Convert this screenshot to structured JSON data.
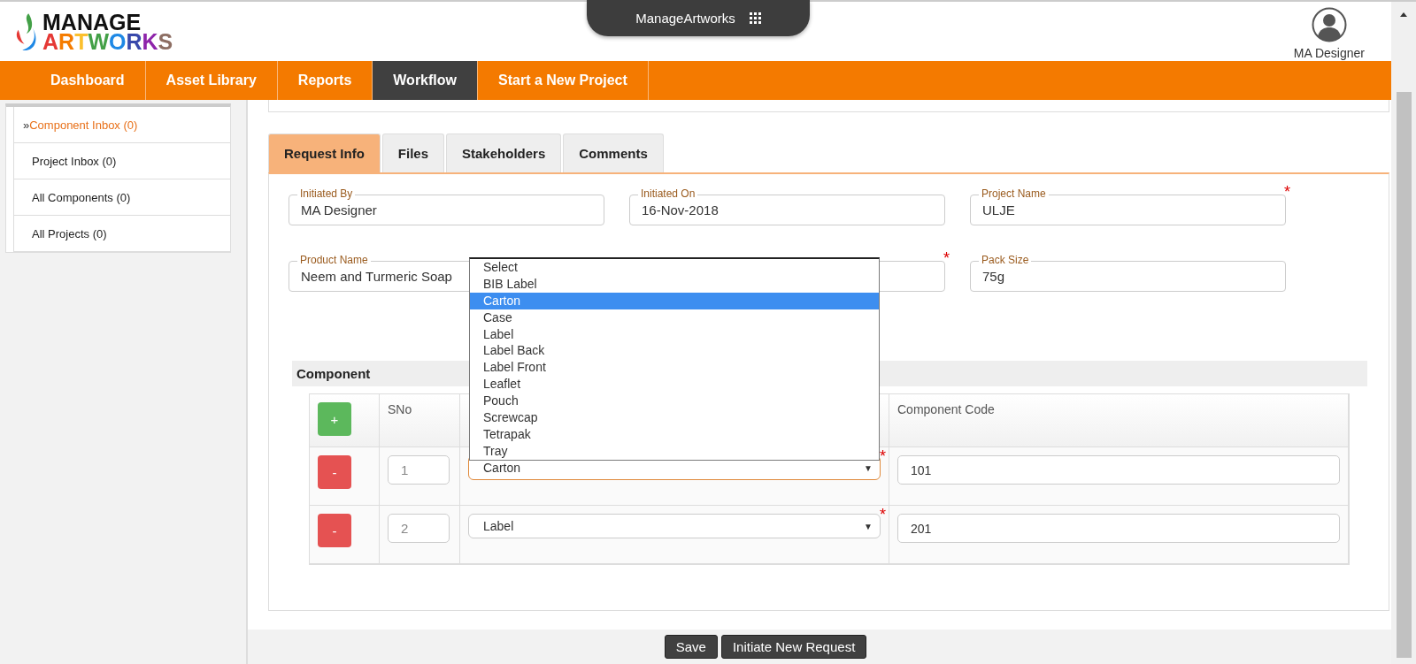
{
  "logo": {
    "line_1": "MANAGE",
    "line_2": "ARTWORKS"
  },
  "app_switcher": {
    "label": "ManageArtworks"
  },
  "user": {
    "name": "MA Designer"
  },
  "nav": [
    {
      "label": "Dashboard",
      "selected": false
    },
    {
      "label": "Asset Library",
      "selected": false
    },
    {
      "label": "Reports",
      "selected": false
    },
    {
      "label": "Workflow",
      "selected": true
    },
    {
      "label": "Start a New Project",
      "selected": false
    }
  ],
  "sidebar": {
    "marker": "»",
    "items": [
      {
        "label": "Component Inbox (0)",
        "selected": true
      },
      {
        "label": "Project Inbox (0)",
        "selected": false
      },
      {
        "label": "All Components (0)",
        "selected": false
      },
      {
        "label": "All Projects (0)",
        "selected": false
      }
    ]
  },
  "tabs": [
    {
      "label": "Request Info",
      "selected": true
    },
    {
      "label": "Files",
      "selected": false
    },
    {
      "label": "Stakeholders",
      "selected": false
    },
    {
      "label": "Comments",
      "selected": false
    }
  ],
  "fields": [
    {
      "label": "Initiated By",
      "value": "MA Designer"
    },
    {
      "label": "Initiated On",
      "value": "16-Nov-2018"
    },
    {
      "label": "Project Name",
      "value": "ULJE",
      "required_mark": "*"
    },
    {
      "label": "Product Name",
      "value": "Neem and Turmeric Soap"
    },
    {
      "required_mark": "*"
    },
    {
      "label": "Pack Size",
      "value": "75g"
    }
  ],
  "component": {
    "title": "Component",
    "add_button": "+",
    "columns": [
      "SNo",
      "Component Code"
    ],
    "rows": [
      {
        "remove": "-",
        "sno": "1",
        "type": "Carton",
        "caret": "▼",
        "required_mark": "*",
        "code": "101",
        "focused": true
      },
      {
        "remove": "-",
        "sno": "2",
        "type": "Label",
        "caret": "▼",
        "required_mark": "*",
        "code": "201",
        "focused": false
      }
    ]
  },
  "dropdown": {
    "options": [
      {
        "label": "Select",
        "selected": false
      },
      {
        "label": "BIB Label",
        "selected": false
      },
      {
        "label": "Carton",
        "selected": true
      },
      {
        "label": "Case",
        "selected": false
      },
      {
        "label": "Label",
        "selected": false
      },
      {
        "label": "Label Back",
        "selected": false
      },
      {
        "label": "Label Front",
        "selected": false
      },
      {
        "label": "Leaflet",
        "selected": false
      },
      {
        "label": "Pouch",
        "selected": false
      },
      {
        "label": "Screwcap",
        "selected": false
      },
      {
        "label": "Tetrapak",
        "selected": false
      },
      {
        "label": "Tray",
        "selected": false
      }
    ]
  },
  "buttons": [
    "Save",
    "Initiate New Request"
  ]
}
